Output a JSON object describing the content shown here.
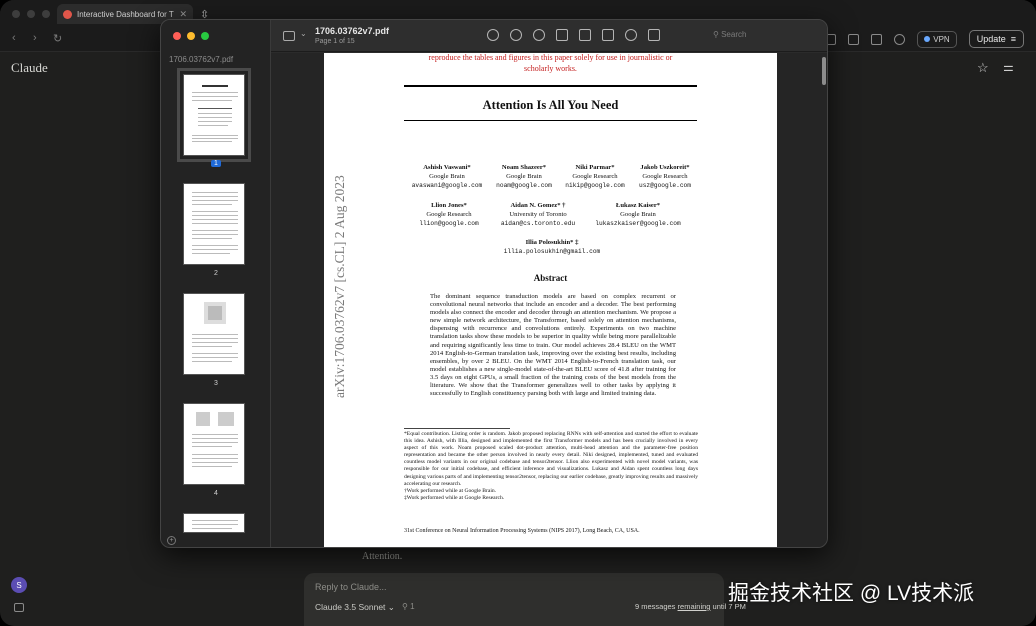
{
  "browser": {
    "tab_title": "Interactive Dashboard for Tra",
    "vpn_label": "VPN",
    "update_label": "Update"
  },
  "claude": {
    "app_title": "Claude",
    "partial_text": "Attention.",
    "avatar_initial": "S",
    "reply_placeholder": "Reply to Claude...",
    "model_label": "Claude 3.5 Sonnet",
    "attach_count": "1",
    "messages_prefix": "9 messages ",
    "messages_link": "remaining",
    "messages_suffix": " until 7 PM",
    "settings_badge": "1"
  },
  "preview": {
    "filename": "1706.03762v7.pdf",
    "page_info": "Page 1 of 15",
    "sidebar_filename": "1706.03762v7.pdf",
    "search_placeholder": "Search",
    "thumbnails": [
      "1",
      "2",
      "3",
      "4"
    ]
  },
  "paper": {
    "red_line1": "reproduce the tables and figures in this paper solely for use in journalistic or",
    "red_line2": "scholarly works.",
    "title": "Attention Is All You Need",
    "arxiv_stamp": "arXiv:1706.03762v7  [cs.CL]  2 Aug 2023",
    "authors": [
      {
        "name": "Ashish Vaswani*",
        "affil": "Google Brain",
        "email": "avaswani@google.com"
      },
      {
        "name": "Noam Shazeer*",
        "affil": "Google Brain",
        "email": "noam@google.com"
      },
      {
        "name": "Niki Parmar*",
        "affil": "Google Research",
        "email": "nikip@google.com"
      },
      {
        "name": "Jakob Uszkoreit*",
        "affil": "Google Research",
        "email": "usz@google.com"
      },
      {
        "name": "Llion Jones*",
        "affil": "Google Research",
        "email": "llion@google.com"
      },
      {
        "name": "Aidan N. Gomez* †",
        "affil": "University of Toronto",
        "email": "aidan@cs.toronto.edu"
      },
      {
        "name": "Łukasz Kaiser*",
        "affil": "Google Brain",
        "email": "lukaszkaiser@google.com"
      },
      {
        "name": "Illia Polosukhin* ‡",
        "affil": "",
        "email": "illia.polosukhin@gmail.com"
      }
    ],
    "abstract_heading": "Abstract",
    "abstract": "The dominant sequence transduction models are based on complex recurrent or convolutional neural networks that include an encoder and a decoder. The best performing models also connect the encoder and decoder through an attention mechanism. We propose a new simple network architecture, the Transformer, based solely on attention mechanisms, dispensing with recurrence and convolutions entirely. Experiments on two machine translation tasks show these models to be superior in quality while being more parallelizable and requiring significantly less time to train. Our model achieves 28.4 BLEU on the WMT 2014 English-to-German translation task, improving over the existing best results, including ensembles, by over 2 BLEU. On the WMT 2014 English-to-French translation task, our model establishes a new single-model state-of-the-art BLEU score of 41.8 after training for 3.5 days on eight GPUs, a small fraction of the training costs of the best models from the literature. We show that the Transformer generalizes well to other tasks by applying it successfully to English constituency parsing both with large and limited training data.",
    "footnote_main": "*Equal contribution. Listing order is random. Jakob proposed replacing RNNs with self-attention and started the effort to evaluate this idea. Ashish, with Illia, designed and implemented the first Transformer models and has been crucially involved in every aspect of this work. Noam proposed scaled dot-product attention, multi-head attention and the parameter-free position representation and became the other person involved in nearly every detail. Niki designed, implemented, tuned and evaluated countless model variants in our original codebase and tensor2tensor. Llion also experimented with novel model variants, was responsible for our initial codebase, and efficient inference and visualizations. Lukasz and Aidan spent countless long days designing various parts of and implementing tensor2tensor, replacing our earlier codebase, greatly improving results and massively accelerating our research.",
    "footnote_dagger": "†Work performed while at Google Brain.",
    "footnote_ddagger": "‡Work performed while at Google Research.",
    "conference": "31st Conference on Neural Information Processing Systems (NIPS 2017), Long Beach, CA, USA."
  },
  "watermark": "掘金技术社区 @ LV技术派"
}
